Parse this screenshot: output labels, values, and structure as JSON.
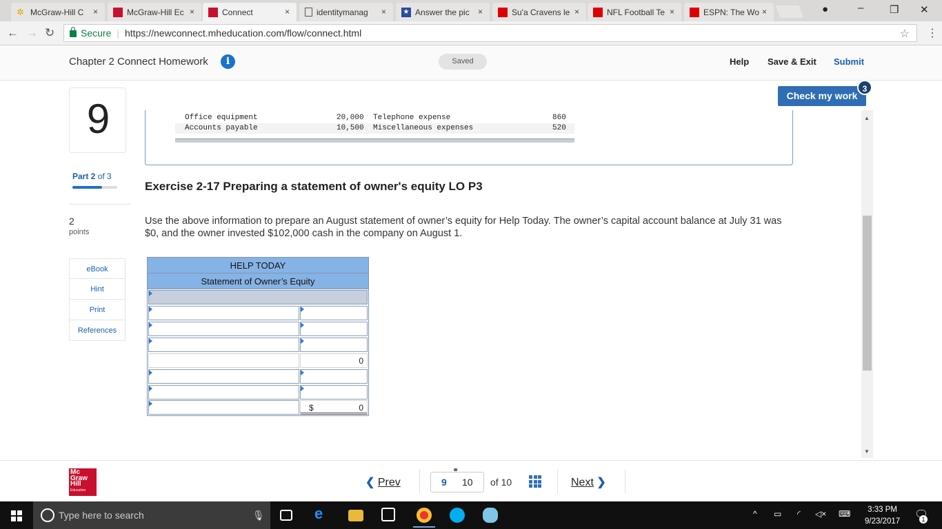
{
  "browser": {
    "tabs": [
      {
        "label": "McGraw-Hill C",
        "active": false
      },
      {
        "label": "McGraw-Hill Ec",
        "active": false
      },
      {
        "label": "Connect",
        "active": true
      },
      {
        "label": "identitymanag",
        "active": false
      },
      {
        "label": "Answer the pic",
        "active": false
      },
      {
        "label": "Su'a Cravens le",
        "active": false
      },
      {
        "label": "NFL Football Te",
        "active": false
      },
      {
        "label": "ESPN: The Wo",
        "active": false
      }
    ],
    "tab_close": "×",
    "secure_label": "Secure",
    "url": "https://newconnect.mheducation.com/flow/connect.html"
  },
  "header": {
    "title": "Chapter 2 Connect Homework",
    "info": "i",
    "status": "Saved",
    "help": "Help",
    "save_exit": "Save & Exit",
    "submit": "Submit"
  },
  "check": {
    "label": "Check my work",
    "badge": "3"
  },
  "question": {
    "number": "9",
    "part_bold": "Part 2",
    "part_rest": " of 3",
    "part_progress": 0.667,
    "points_value": "2",
    "points_label": "points"
  },
  "sidebar": {
    "items": [
      "eBook",
      "Hint",
      "Print",
      "References"
    ]
  },
  "data_rows": [
    {
      "label": "Office equipment",
      "amount": "20,000",
      "label2": "Telephone expense",
      "amount2": "860"
    },
    {
      "label": "Accounts payable",
      "amount": "10,500",
      "label2": "Miscellaneous expenses",
      "amount2": "520"
    }
  ],
  "exercise": {
    "title": "Exercise 2-17 Preparing a statement of owner's equity LO P3",
    "body": "Use the above information to prepare an August statement of owner’s equity for Help Today. The owner’s capital account balance at July 31 was $0, and the owner invested $102,000 cash in the company on August 1."
  },
  "statement": {
    "company": "HELP TODAY",
    "title": "Statement of Owner’s Equity",
    "subtotal": "0",
    "dollar": "$",
    "total": "0"
  },
  "footer": {
    "prev": "Prev",
    "current_page": "9",
    "page_field": "10",
    "of_text": "of 10",
    "next": "Next",
    "logo_lines": [
      "Mc",
      "Graw",
      "Hill",
      "Education"
    ]
  },
  "taskbar": {
    "search_placeholder": "Type here to search",
    "time": "3:33 PM",
    "date": "9/23/2017",
    "notification_count": "1"
  },
  "colors": {
    "accent": "#2f6db5",
    "header_blue": "#86b3e6",
    "brand_red": "#c8102e"
  }
}
